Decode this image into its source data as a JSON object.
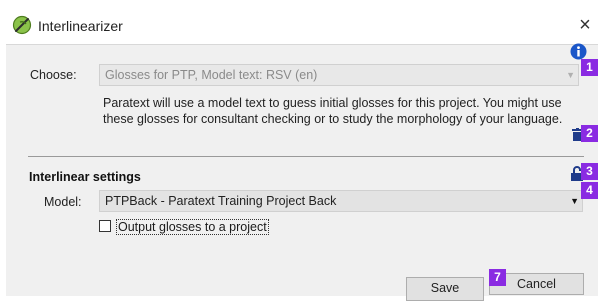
{
  "window": {
    "title": "Interlinearizer",
    "close_glyph": "×"
  },
  "choose": {
    "label": "Choose:",
    "value": "Glosses for PTP, Model text: RSV (en)",
    "description": "Paratext will use a model text to guess initial glosses for this project. You might use these glosses for consultant checking or to study the morphology of your language."
  },
  "settings": {
    "heading": "Interlinear settings",
    "model_label": "Model:",
    "model_value": "PTPBack - Paratext Training Project Back",
    "output_checkbox_label": "Output glosses to a project",
    "output_checked": false
  },
  "buttons": {
    "save": "Save",
    "cancel": "Cancel"
  },
  "badges": [
    "1",
    "2",
    "3",
    "4",
    "7"
  ],
  "icons": {
    "title": "app-leaf-icon",
    "info": "info-icon",
    "delete": "trash-icon",
    "lock": "unlock-icon",
    "dropdown": "chevron-down-icon"
  },
  "colors": {
    "badge": "#8a2be2",
    "info": "#1a56c8",
    "icon_blue": "#1f3b8a",
    "app_icon": "#7cb342"
  }
}
